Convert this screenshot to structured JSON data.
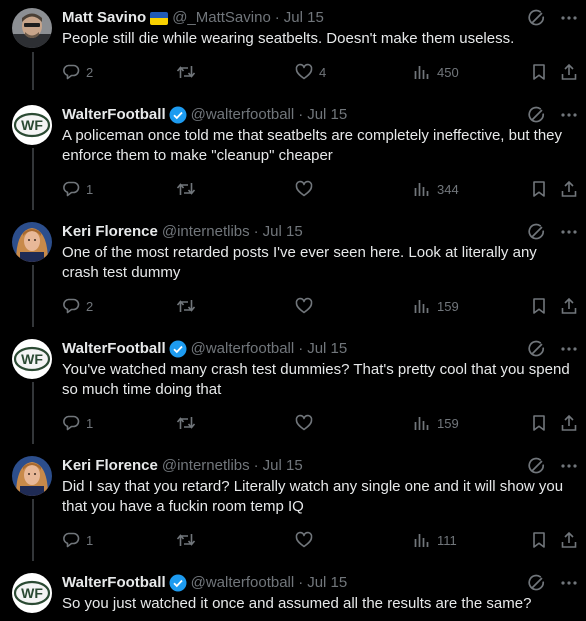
{
  "tweets": [
    {
      "name": "Matt Savino",
      "handle": "@_MattSavino",
      "date": "Jul 15",
      "text": "People still die while wearing seatbelts. Doesn't make them useless.",
      "replies": "2",
      "retweets": "",
      "likes": "4",
      "views": "450",
      "avatar": "matt-photo",
      "flag": "ukraine-flag",
      "verified": false
    },
    {
      "name": "WalterFootball",
      "handle": "@walterfootball",
      "date": "Jul 15",
      "text": "A policeman once told me that seatbelts are completely ineffective, but they enforce them to make \"cleanup\" cheaper",
      "replies": "1",
      "retweets": "",
      "likes": "",
      "views": "344",
      "avatar": "wf-logo",
      "verified": true
    },
    {
      "name": "Keri Florence",
      "handle": "@internetlibs",
      "date": "Jul 15",
      "text": "One of the most retarded posts I've ever seen here. Look at literally any crash test dummy",
      "replies": "2",
      "retweets": "",
      "likes": "",
      "views": "159",
      "avatar": "keri-photo",
      "verified": false
    },
    {
      "name": "WalterFootball",
      "handle": "@walterfootball",
      "date": "Jul 15",
      "text": "You've watched many crash test dummies? That's pretty cool that you spend so much time doing that",
      "replies": "1",
      "retweets": "",
      "likes": "",
      "views": "159",
      "avatar": "wf-logo",
      "verified": true
    },
    {
      "name": "Keri Florence",
      "handle": "@internetlibs",
      "date": "Jul 15",
      "text": "Did I say that you retard? Literally watch any single one and it will show you that you have a fuckin room temp IQ",
      "replies": "1",
      "retweets": "",
      "likes": "",
      "views": "111",
      "avatar": "keri-photo",
      "verified": false
    },
    {
      "name": "WalterFootball",
      "handle": "@walterfootball",
      "date": "Jul 15",
      "text": "So you just watched it once and assumed all the results are the same?",
      "avatar": "wf-logo",
      "verified": true
    }
  ],
  "separator": "·",
  "colors": {
    "background": "#000000",
    "text": "#e7e9ea",
    "secondary": "#71767b",
    "verified": "#1d9bf0",
    "thread_line": "#333639"
  },
  "icons": [
    "grok-icon",
    "more-icon",
    "reply-icon",
    "retweet-icon",
    "like-icon",
    "views-icon",
    "bookmark-icon",
    "share-icon"
  ]
}
